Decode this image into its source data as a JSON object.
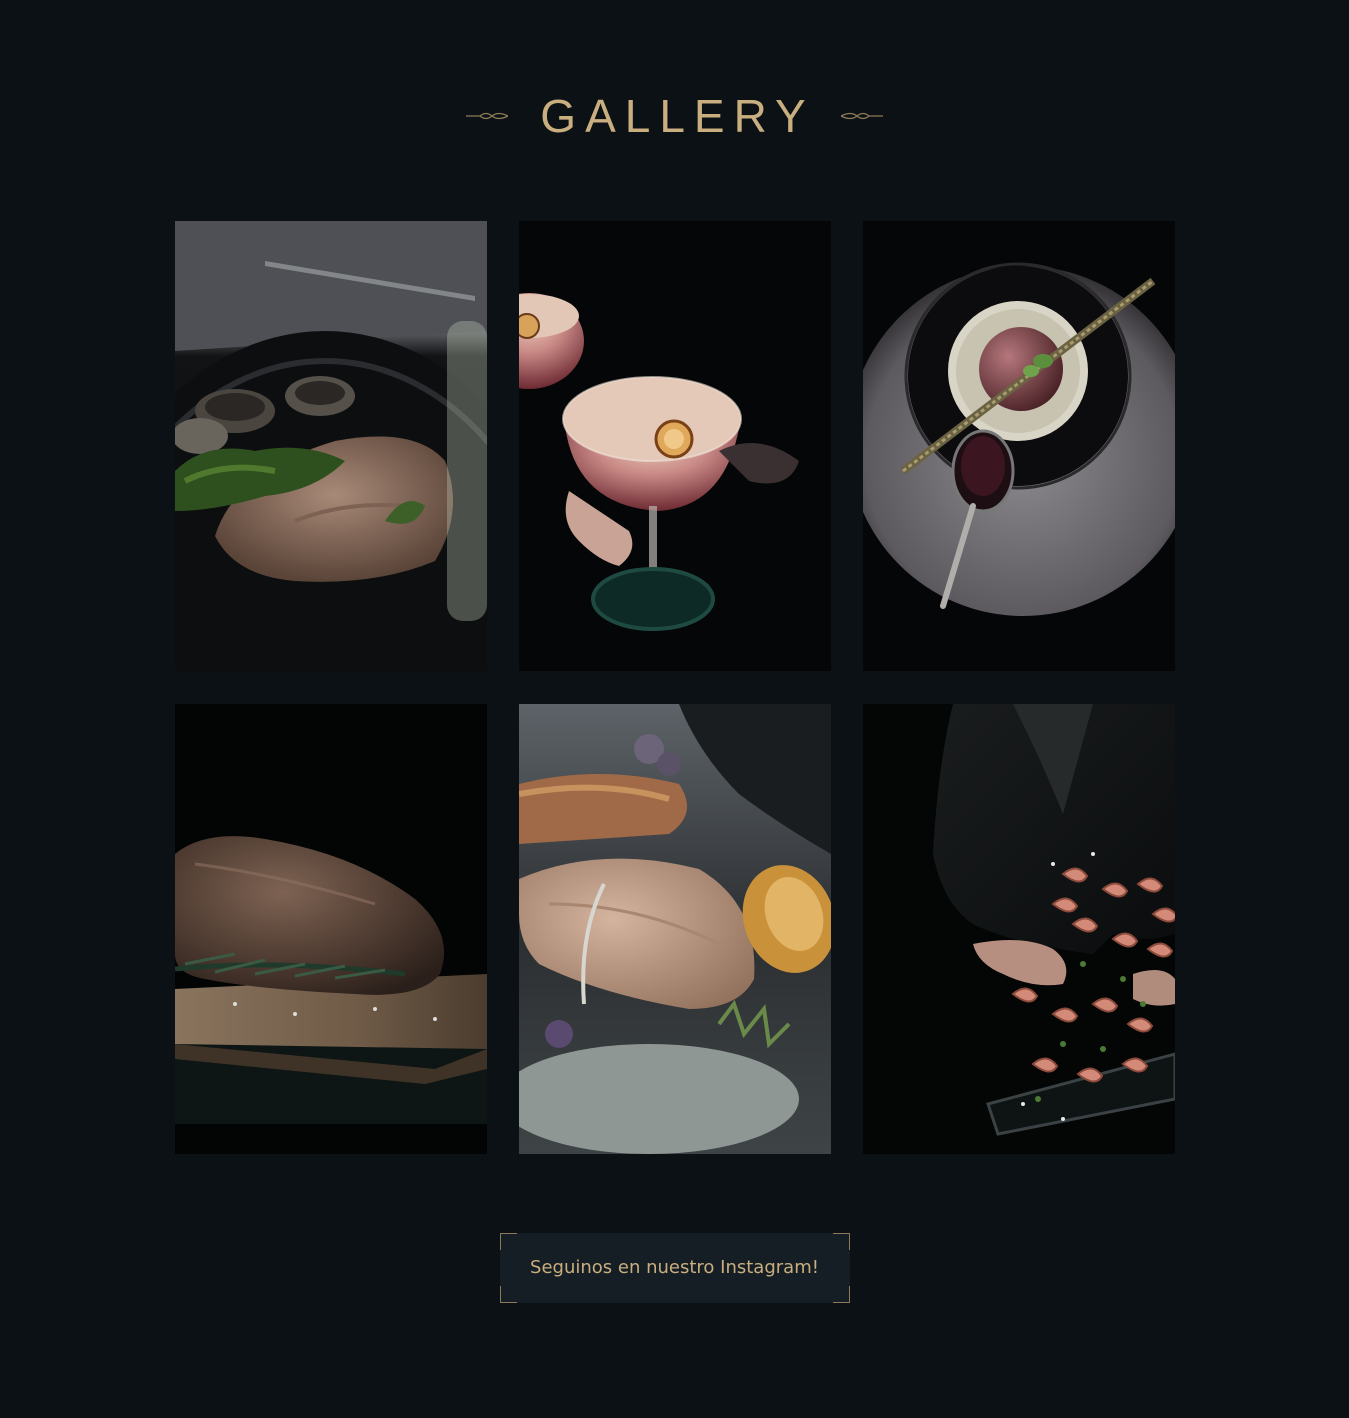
{
  "section": {
    "title": "GALLERY"
  },
  "gallery": {
    "items": [
      {
        "subject": "pork loin with clams and herbs in cast iron pan"
      },
      {
        "subject": "pink cocktail in coupe glass with dried orange slice"
      },
      {
        "subject": "plated dessert with crumble and spoon of jam"
      },
      {
        "subject": "seared beef roast with rosemary on wooden board"
      },
      {
        "subject": "roasted fish fillet with grilled lemon"
      },
      {
        "subject": "chef tossing shrimp in a pan"
      }
    ]
  },
  "cta": {
    "label": "Seguinos en nuestro Instagram!"
  },
  "colors": {
    "background": "#0b1114",
    "accent_gold": "#c9ae7f",
    "button_bg": "#151e24"
  }
}
